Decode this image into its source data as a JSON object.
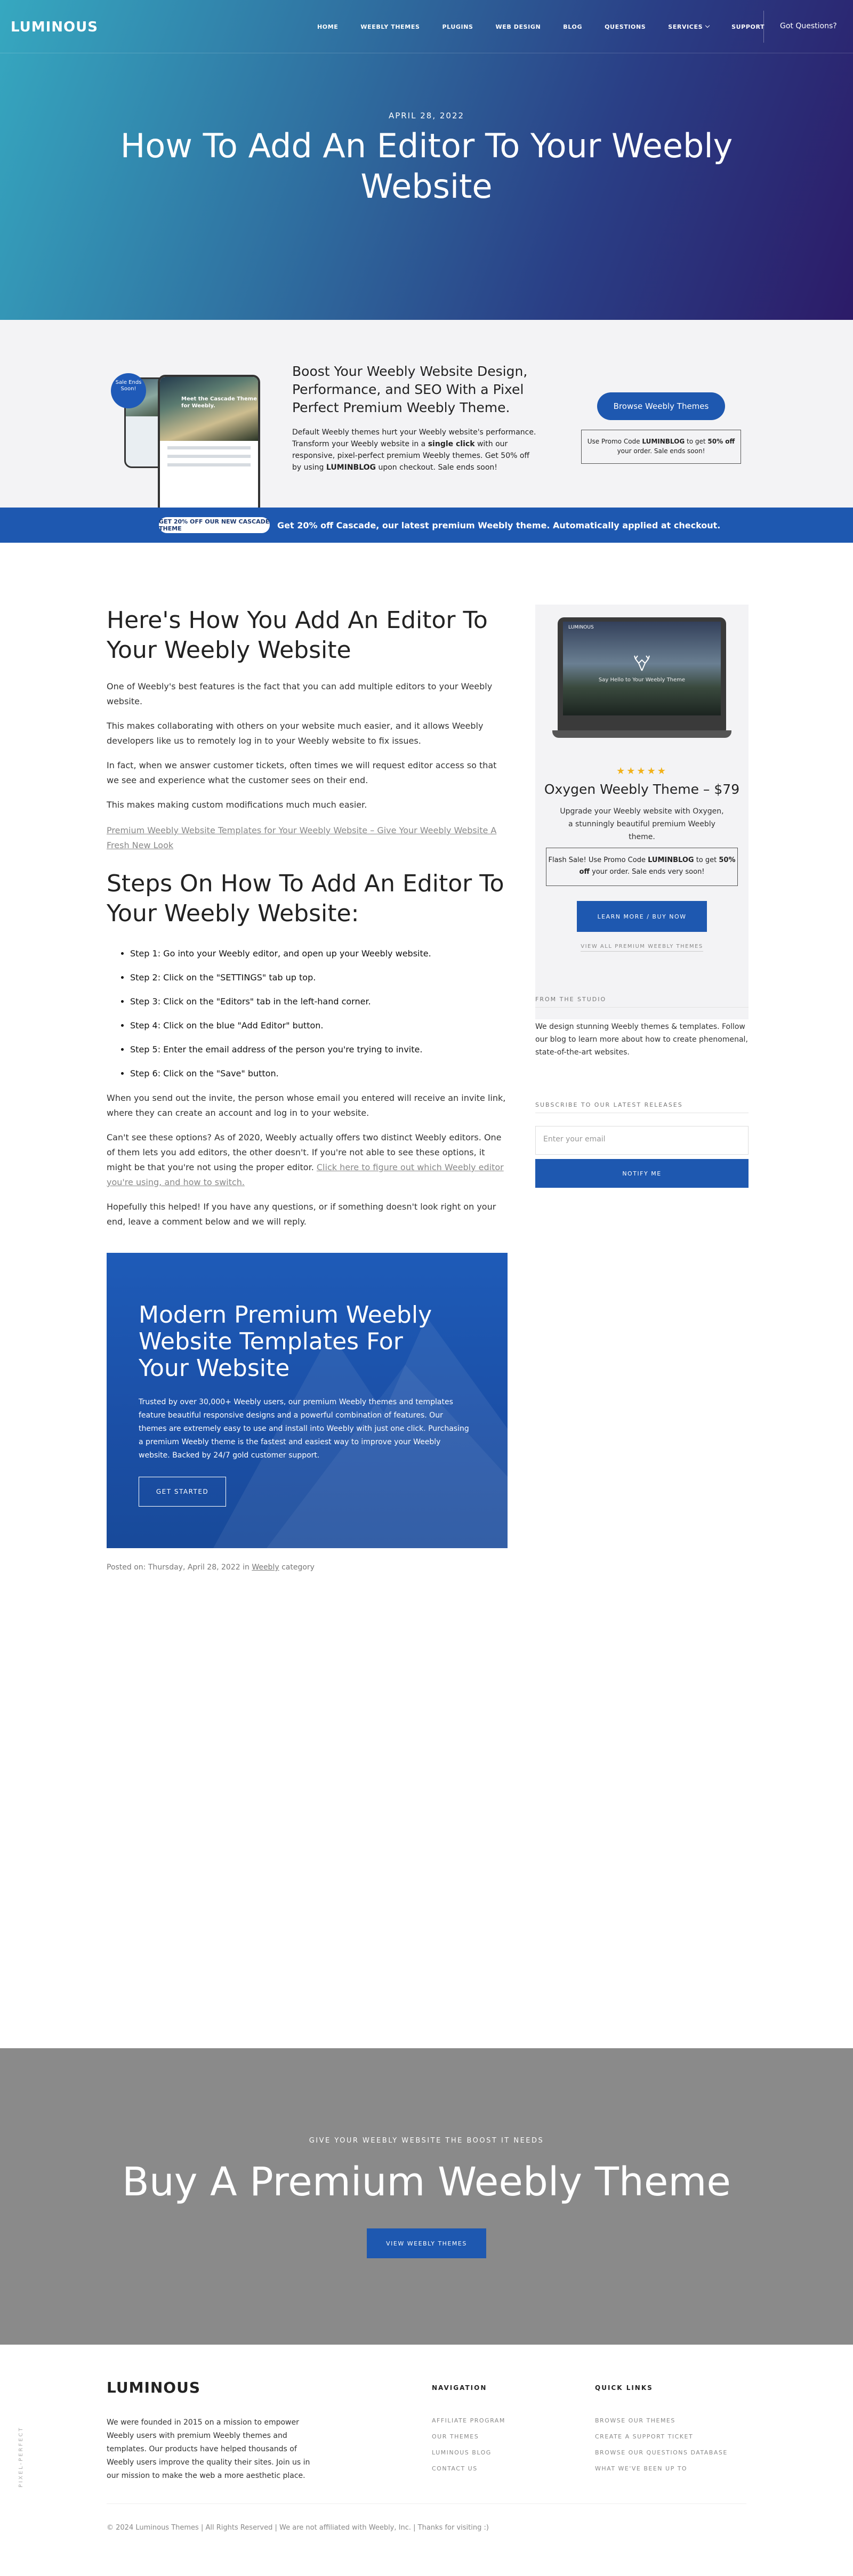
{
  "header": {
    "logo": "LUMINOUS",
    "nav": [
      "HOME",
      "WEEBLY THEMES",
      "PLUGINS",
      "WEB DESIGN",
      "BLOG",
      "QUESTIONS",
      "SERVICES",
      "SUPPORT"
    ],
    "cta": "Got Questions?"
  },
  "hero": {
    "date": "APRIL 28, 2022",
    "title": "How To Add An Editor To Your Weebly Website"
  },
  "promo": {
    "badge": "Sale Ends Soon!",
    "device_text": "Meet the Cascade Theme for Weebly.",
    "heading": "Boost Your Weebly Website Design, Performance, and SEO With a Pixel Perfect Premium Weebly Theme.",
    "body_1": "Default Weebly themes hurt your Weebly website's performance. Transform your Weebly website in a ",
    "body_bold": "single click",
    "body_2": " with our responsive, pixel-perfect premium Weebly themes. Get 50% off by using ",
    "body_code": "LUMINBLOG",
    "body_3": " upon checkout. Sale ends soon!",
    "button": "Browse Weebly Themes",
    "code_1": "Use Promo Code ",
    "code_code": "LUMINBLOG",
    "code_2": " to get ",
    "code_pct": "50% off",
    "code_3": " your order. Sale ends soon!"
  },
  "announce": {
    "pill": "GET 20% OFF OUR NEW CASCADE THEME",
    "message": "Get 20% off Cascade, our latest premium Weebly theme. Automatically applied at checkout."
  },
  "article": {
    "h1": "Here's How You Add An Editor To Your Weebly Website",
    "p1": "One of Weebly's best features is the fact that you can add multiple editors to your Weebly website.",
    "p2": "This makes collaborating with others on your website much easier, and it allows Weebly developers like us to remotely log in to your Weebly website to fix issues.",
    "p3": "In fact, when we answer customer tickets, often times we will request editor access so that we see and experience what the customer sees on their end.",
    "p4": "This makes making custom modifications much much easier.",
    "link": "Premium Weebly Website Templates for Your Weebly Website – Give Your Weebly Website A Fresh New Look",
    "h2": "Steps On How To Add An Editor To Your Weebly Website:",
    "steps": [
      "Step 1: Go into your Weebly editor, and open up your Weebly website.",
      "Step 2: Click on the \"SETTINGS\" tab up top.",
      "Step 3: Click on the \"Editors\" tab in the left-hand corner.",
      "Step 4: Click on the blue \"Add Editor\" button.",
      "Step 5: Enter the email address of the person you're trying to invite.",
      "Step 6: Click on the \"Save\" button."
    ],
    "p5": "When you send out the invite, the person whose email you entered will receive an invite link, where they can create an account and log in to your website.",
    "p6a": "Can't see these options? As of 2020, Weebly actually offers two distinct Weebly editors. One of them lets you add editors, the other doesn't. If you're not able to see these options, it might be that you're not using the proper editor. ",
    "p6link": "Click here to figure out which Weebly editor you're using, and how to switch.",
    "p7": "Hopefully this helped! If you have any questions, or if something doesn't look right on your end, leave a comment below and we will reply.",
    "cta_title": "Modern Premium Weebly Website Templates For Your Website",
    "cta_body": "Trusted by over 30,000+ Weebly users, our premium Weebly themes and templates feature beautiful responsive designs and a powerful combination of features. Our themes are extremely easy to use and install into Weebly with just one click. Purchasing a premium Weebly theme is the fastest and easiest way to improve your Weebly website. Backed by 24/7 gold customer support.",
    "cta_button": "GET STARTED",
    "posted_prefix": "Posted on: Thursday, April 28, 2022 in ",
    "posted_cat": "Weebly",
    "posted_suffix": " category"
  },
  "sidebar": {
    "screen_logo": "LUMINOUS",
    "screen_text": "Say Hello to Your Weebly Theme",
    "stars": "★★★★★",
    "rating": 5,
    "product": "Oxygen Weebly Theme – $79",
    "desc": "Upgrade your Weebly website with Oxygen, a stunningly beautiful premium Weebly theme.",
    "flash_1": "Flash Sale! Use Promo Code ",
    "flash_code": "LUMINBLOG",
    "flash_2": " to get ",
    "flash_pct": "50% off",
    "flash_3": " your order. Sale ends very soon!",
    "learn": "LEARN MORE / BUY NOW",
    "viewall": "VIEW ALL PREMIUM WEEBLY THEMES",
    "studio_h": "FROM THE STUDIO",
    "studio_p": "We design stunning Weebly themes & templates. Follow our blog to learn more about how to create phenomenal, state-of-the-art websites.",
    "sub_h": "SUBSCRIBE TO OUR LATEST RELEASES",
    "email_placeholder": "Enter your email",
    "notify": "NOTIFY ME"
  },
  "banner": {
    "kicker": "GIVE YOUR WEEBLY WEBSITE THE BOOST IT NEEDS",
    "title": "Buy A Premium Weebly Theme",
    "button": "VIEW WEEBLY THEMES"
  },
  "footer": {
    "vertical": "PIXEL-PERFECT",
    "logo": "LUMINOUS",
    "about": "We were founded in 2015 on a mission to empower Weebly users with premium Weebly themes and templates. Our products have helped thousands of Weebly users improve the quality their sites. Join us in our mission to make the web a more aesthetic place.",
    "nav_h": "NAVIGATION",
    "nav": [
      "AFFILIATE PROGRAM",
      "OUR THEMES",
      "LUMINOUS BLOG",
      "CONTACT US"
    ],
    "links_h": "QUICK LINKS",
    "links": [
      "BROWSE OUR THEMES",
      "CREATE A SUPPORT TICKET",
      "BROWSE OUR QUESTIONS DATABASE",
      "WHAT WE'VE BEEN UP TO"
    ],
    "copyright": "© 2024 Luminous Themes | All Rights Reserved | We are not affiliated with Weebly, Inc. | Thanks for visiting :)"
  },
  "colors": {
    "brand_blue": "#1e58b0",
    "star": "#f2b21a",
    "grey_banner": "#8a8a8a"
  }
}
